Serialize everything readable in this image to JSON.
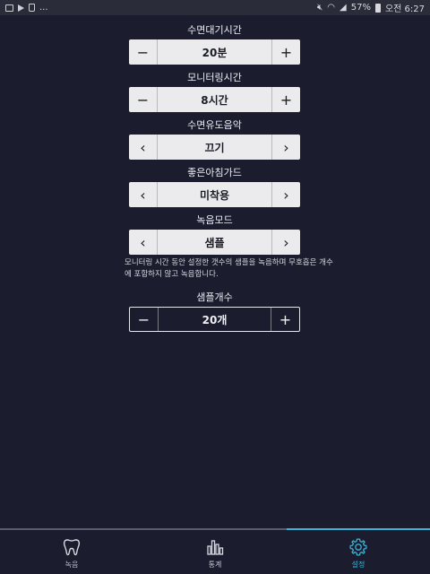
{
  "statusbar": {
    "left_text": "...",
    "battery": "57%",
    "time": "오전 6:27"
  },
  "settings": [
    {
      "label": "수면대기시간",
      "value": "20분",
      "left": "−",
      "right": "+"
    },
    {
      "label": "모니터링시간",
      "value": "8시간",
      "left": "−",
      "right": "+"
    },
    {
      "label": "수면유도음악",
      "value": "끄기",
      "left": "‹",
      "right": "›"
    },
    {
      "label": "좋은아침가드",
      "value": "미착용",
      "left": "‹",
      "right": "›"
    },
    {
      "label": "녹음모드",
      "value": "샘플",
      "left": "‹",
      "right": "›"
    }
  ],
  "description": "모니터링 시간 동안 설정한 갯수의 샘플을 녹음하며 무호흡은 개수에 포함하지 않고 녹음합니다.",
  "sample_count": {
    "label": "샘플개수",
    "value": "20개",
    "left": "−",
    "right": "+"
  },
  "tabs": [
    {
      "label": "녹음",
      "icon": "tooth-icon"
    },
    {
      "label": "통계",
      "icon": "bar-chart-icon"
    },
    {
      "label": "설정",
      "icon": "gear-icon"
    }
  ],
  "colors": {
    "background": "#1b1d2e",
    "accent": "#3cb2d6",
    "control_bg": "#ebebee"
  }
}
